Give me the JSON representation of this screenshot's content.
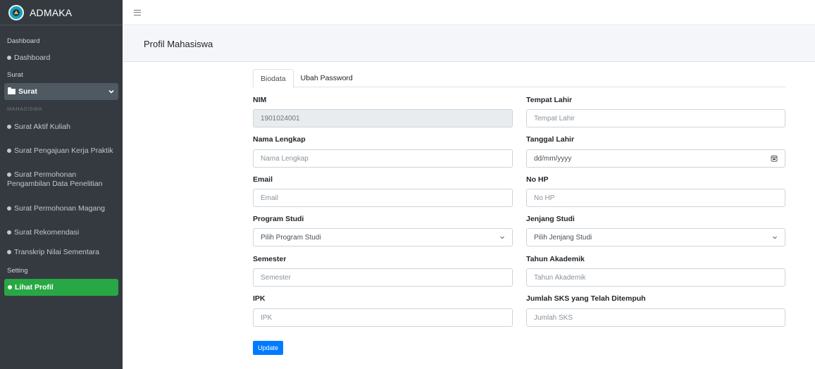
{
  "brand": {
    "name": "ADMAKA"
  },
  "sidebar": {
    "sections": {
      "dashboard_header": "Dashboard",
      "surat_header": "Surat",
      "mahasiswa_header": "MAHASISWA",
      "setting_header": "Setting"
    },
    "dashboard_link": "Dashboard",
    "surat_menu": "Surat",
    "items": [
      "Surat Aktif Kuliah",
      "Surat Pengajuan Kerja Praktik",
      "Surat Permohonan Pengambilan Data Penelitian",
      "Surat Permohonan Magang",
      "Surat Rekomendasi",
      "Transkrip Nilai Sementara"
    ],
    "active_item": "Lihat Profil"
  },
  "header": {
    "title": "Profil Mahasiswa"
  },
  "tabs": [
    {
      "label": "Biodata",
      "active": true
    },
    {
      "label": "Ubah Password",
      "active": false
    }
  ],
  "form": {
    "nim": {
      "label": "NIM",
      "value": "1901024001"
    },
    "tempat_lahir": {
      "label": "Tempat Lahir",
      "placeholder": "Tempat Lahir"
    },
    "nama_lengkap": {
      "label": "Nama Lengkap",
      "placeholder": "Nama Lengkap"
    },
    "tanggal_lahir": {
      "label": "Tanggal Lahir",
      "placeholder": "dd/mm/yyyy"
    },
    "email": {
      "label": "Email",
      "placeholder": "Email"
    },
    "no_hp": {
      "label": "No HP",
      "placeholder": "No HP"
    },
    "program_studi": {
      "label": "Program Studi",
      "selected": "Pilih Program Studi"
    },
    "jenjang_studi": {
      "label": "Jenjang Studi",
      "selected": "Pilih Jenjang Studi"
    },
    "semester": {
      "label": "Semester",
      "placeholder": "Semester"
    },
    "tahun_akademik": {
      "label": "Tahun Akademik",
      "placeholder": "Tahun Akademik"
    },
    "ipk": {
      "label": "IPK",
      "placeholder": "IPK"
    },
    "jumlah_sks": {
      "label": "Jumlah SKS yang Telah Ditempuh",
      "placeholder": "Jumlah SKS"
    },
    "update_label": "Update"
  },
  "colors": {
    "sidebar_bg": "#343a40",
    "active_green": "#28a745",
    "primary_blue": "#007bff",
    "brand_logo": "#17a2b8"
  },
  "icons": [
    "logo-icon",
    "hamburger-icon",
    "folder-icon",
    "chevron-down-icon",
    "calendar-icon",
    "dot-icon"
  ]
}
